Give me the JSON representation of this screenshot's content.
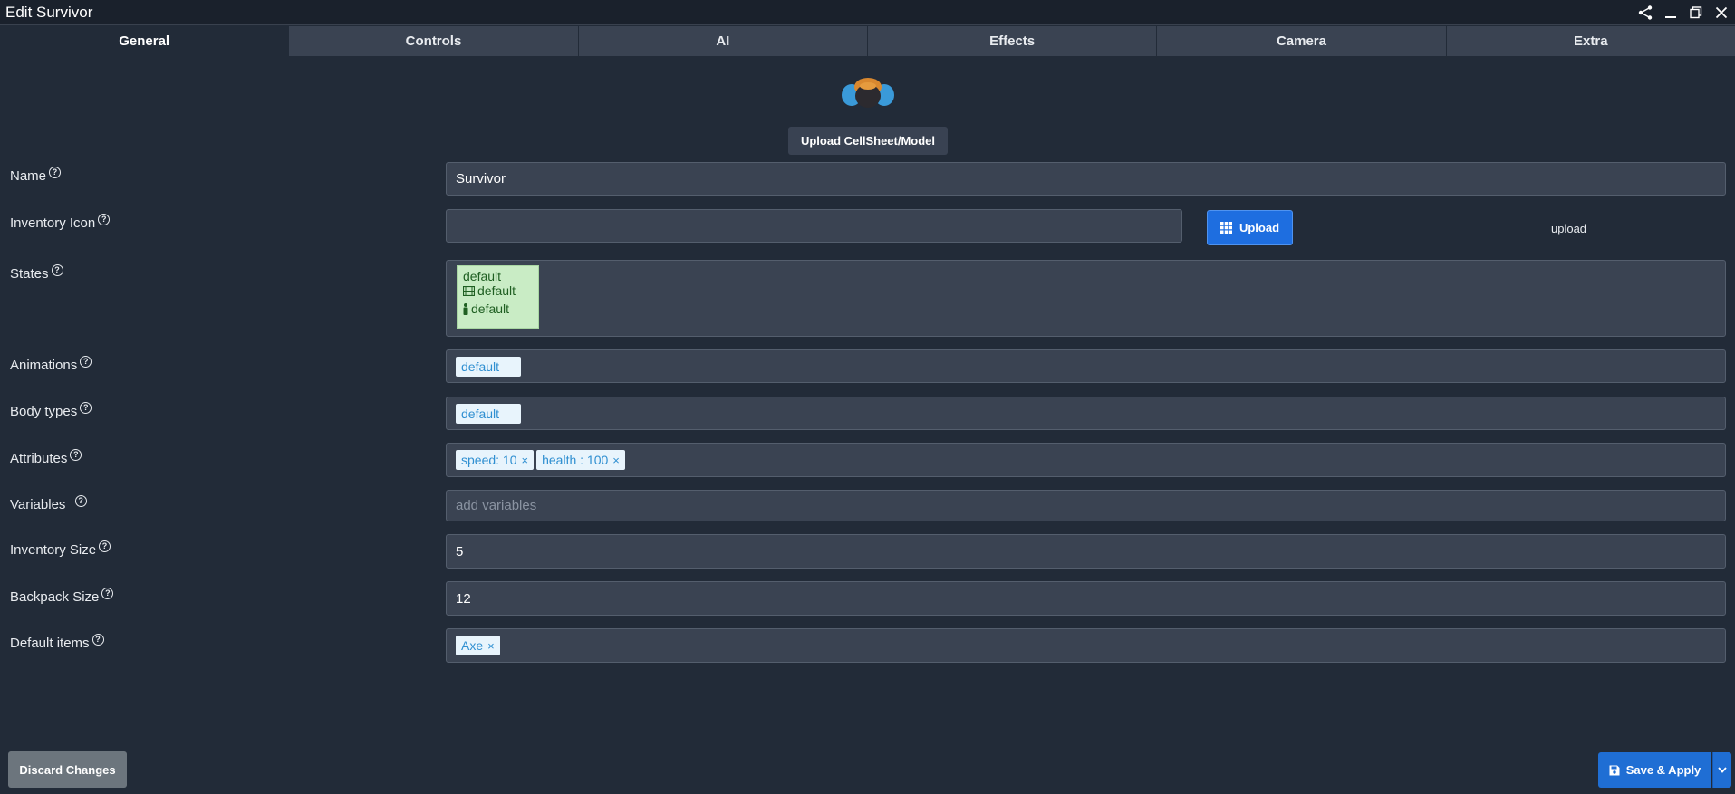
{
  "window": {
    "title": "Edit Survivor",
    "controls": [
      "share-icon",
      "minimize-icon",
      "maximize-icon",
      "close-icon"
    ]
  },
  "tabs": [
    {
      "label": "General",
      "active": true
    },
    {
      "label": "Controls",
      "active": false
    },
    {
      "label": "AI",
      "active": false
    },
    {
      "label": "Effects",
      "active": false
    },
    {
      "label": "Camera",
      "active": false
    },
    {
      "label": "Extra",
      "active": false
    }
  ],
  "model": {
    "upload_label": "Upload CellSheet/Model"
  },
  "form": {
    "name": {
      "label": "Name",
      "value": "Survivor"
    },
    "inventory_icon": {
      "label": "Inventory Icon",
      "value": "",
      "upload_label": "Upload",
      "broken_image_alt": "upload"
    },
    "states": {
      "label": "States",
      "items": [
        {
          "name": "default",
          "animation": "default",
          "body_type": "default"
        }
      ]
    },
    "animations": {
      "label": "Animations",
      "chips": [
        "default"
      ]
    },
    "body_types": {
      "label": "Body types",
      "chips": [
        "default"
      ]
    },
    "attributes": {
      "label": "Attributes",
      "chips": [
        "speed: 10",
        "health : 100"
      ]
    },
    "variables": {
      "label": "Variables",
      "placeholder": "add variables"
    },
    "inventory_size": {
      "label": "Inventory Size",
      "value": "5"
    },
    "backpack_size": {
      "label": "Backpack Size",
      "value": "12"
    },
    "default_items": {
      "label": "Default items",
      "chips": [
        "Axe"
      ]
    }
  },
  "footer": {
    "discard_label": "Discard Changes",
    "save_label": "Save & Apply"
  },
  "colors": {
    "background": "#222b38",
    "field": "#3a4352",
    "primary": "#1f6ed4",
    "state_card": "#c9ecc5"
  }
}
